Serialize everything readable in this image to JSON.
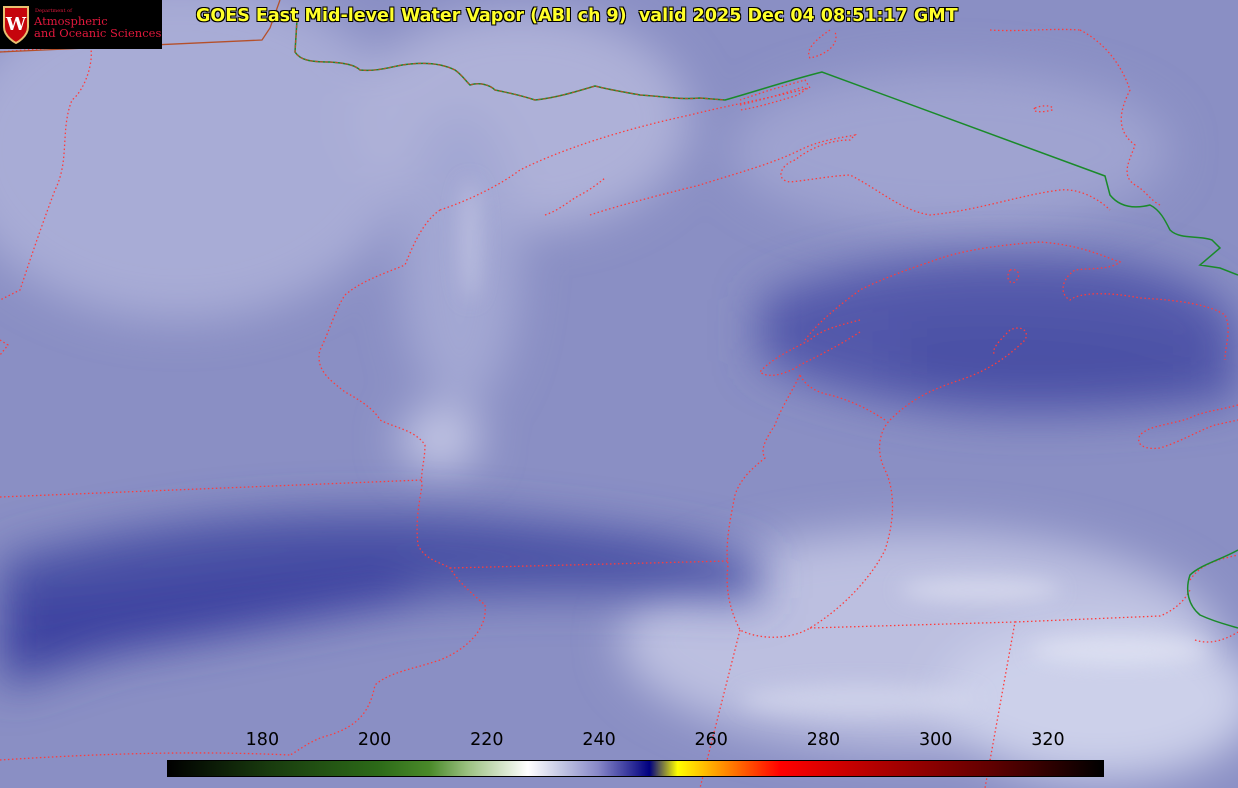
{
  "header": {
    "title": "GOES East Mid-level Water Vapor (ABI ch 9)  valid 2025 Dec 04 08:51:17 GMT"
  },
  "logo": {
    "department": "Department of",
    "line1": "Atmospheric",
    "line2": "and Oceanic Sciences",
    "seal_letter": "W"
  },
  "colorbar": {
    "unit_ticks": [
      "180",
      "200",
      "220",
      "240",
      "260",
      "280",
      "300",
      "320"
    ],
    "tick_values": [
      180,
      200,
      220,
      240,
      260,
      280,
      300,
      320
    ],
    "min": 163,
    "max": 330
  },
  "colors": {
    "background": "#8a8fc4",
    "dry_band": "#4048a0",
    "moist_band": "#c0c4e2",
    "state_borders": "#ff3b3b",
    "intl_border": "#1a8a2a",
    "title_text": "#ffff2a",
    "logo_text": "#e0183c"
  }
}
